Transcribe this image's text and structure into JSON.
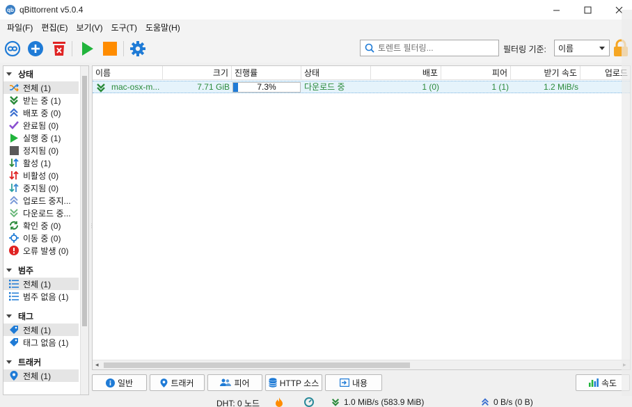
{
  "window": {
    "app_icon": "qb",
    "title": "qBittorrent v5.0.4",
    "minimize": "—",
    "maximize": "☐",
    "close": "✕"
  },
  "menu": [
    {
      "label": "파일(F)"
    },
    {
      "label": "편집(E)"
    },
    {
      "label": "보기(V)"
    },
    {
      "label": "도구(T)"
    },
    {
      "label": "도움말(H)"
    }
  ],
  "toolbar": {
    "icons": [
      "link-icon",
      "add-icon",
      "delete-icon",
      "play-icon",
      "stop-icon",
      "settings-icon"
    ],
    "search_placeholder": "토렌트 필터링...",
    "filter_label": "필터링 기준:",
    "filter_value": "이름"
  },
  "sidebar": {
    "status_header": "상태",
    "status_items": [
      {
        "label": "전체 (1)",
        "icon": "shuffle-icon"
      },
      {
        "label": "받는 중 (1)",
        "icon": "download-chevrons-icon"
      },
      {
        "label": "배포 중 (0)",
        "icon": "upload-chevrons-icon"
      },
      {
        "label": "완료됨 (0)",
        "icon": "check-icon"
      },
      {
        "label": "실행 중 (1)",
        "icon": "play-icon"
      },
      {
        "label": "정지됨 (0)",
        "icon": "stop-icon"
      },
      {
        "label": "활성 (1)",
        "icon": "active-arrows-icon"
      },
      {
        "label": "비활성 (0)",
        "icon": "inactive-arrows-icon"
      },
      {
        "label": "중지됨 (0)",
        "icon": "stopped-arrows-icon"
      },
      {
        "label": "업로드 중지...",
        "icon": "upload-stalled-icon"
      },
      {
        "label": "다운로드 중...",
        "icon": "download-stalled-icon"
      },
      {
        "label": "확인 중 (0)",
        "icon": "refresh-icon"
      },
      {
        "label": "이동 중 (0)",
        "icon": "move-icon"
      },
      {
        "label": "오류 발생 (0)",
        "icon": "error-icon"
      }
    ],
    "category_header": "범주",
    "category_items": [
      {
        "label": "전체 (1)"
      },
      {
        "label": "범주 없음 (1)"
      }
    ],
    "tag_header": "태그",
    "tag_items": [
      {
        "label": "전체 (1)"
      },
      {
        "label": "태그 없음 (1)"
      }
    ],
    "tracker_header": "트래커",
    "tracker_items": [
      {
        "label": "전체 (1)"
      }
    ]
  },
  "table": {
    "columns": [
      "이름",
      "크기",
      "진행률",
      "상태",
      "배포",
      "피어",
      "받기 속도",
      "업로드"
    ],
    "rows": [
      {
        "name": "mac-osx-m...",
        "size": "7.71 GiB",
        "progress": 0.073,
        "progress_label": "7.3%",
        "status": "다운로드 중",
        "seeds": "1 (0)",
        "peers": "1 (1)",
        "down_speed": "1.2 MiB/s"
      }
    ]
  },
  "bottom_tabs": [
    {
      "label": "일반",
      "icon": "info-icon"
    },
    {
      "label": "트래커",
      "icon": "pin-icon"
    },
    {
      "label": "피어",
      "icon": "users-icon"
    },
    {
      "label": "HTTP 소스",
      "icon": "database-icon"
    },
    {
      "label": "내용",
      "icon": "folder-icon"
    }
  ],
  "speed_button": {
    "label": "속도",
    "icon": "chart-icon"
  },
  "statusbar": {
    "dht": "DHT: 0 노드",
    "download": "1.0 MiB/s (583.9 MiB)",
    "upload": "0 B/s (0 B)"
  },
  "colors": {
    "accent_blue": "#1f7bd6",
    "download_green": "#2a8a3a",
    "delete_red": "#e02424",
    "play_green": "#21b43c",
    "stop_orange": "#ff8c00",
    "lock_orange": "#f5a623"
  }
}
